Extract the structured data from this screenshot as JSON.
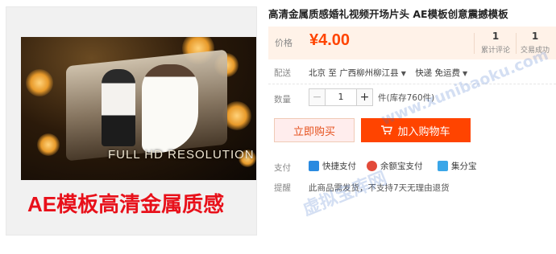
{
  "product": {
    "title": "高清金属质感婚礼视频开场片头 AE模板创意震撼模板",
    "image_caption": "FULL HD RESOLUTION",
    "image_banner": "AE模板高清金属质感"
  },
  "price": {
    "label": "价格",
    "value": "¥4.00",
    "accent_color": "#ff4400"
  },
  "stats": [
    {
      "count": "1",
      "label": "累计评论"
    },
    {
      "count": "1",
      "label": "交易成功"
    }
  ],
  "delivery": {
    "label": "配送",
    "from": "北京 至",
    "to": "广西柳州柳江县",
    "method": "快递 免运费"
  },
  "quantity": {
    "label": "数量",
    "minus": "−",
    "value": "1",
    "plus": "+",
    "stock": "件(库存760件)"
  },
  "actions": {
    "buy_now": "立即购买",
    "add_cart": "加入购物车"
  },
  "payment": {
    "label": "支付",
    "methods": [
      {
        "name": "快捷支付",
        "icon": "quickpay-icon",
        "color": "#2a8ae0"
      },
      {
        "name": "余额宝支付",
        "icon": "yuebao-icon",
        "color": "#e24a3a"
      },
      {
        "name": "集分宝",
        "icon": "jifenbao-icon",
        "color": "#3aa6e8"
      }
    ]
  },
  "notice": {
    "label": "提醒",
    "text": "此商品需发货，不支持7天无理由退货"
  },
  "watermark": {
    "url": "www.xunibaoku.com",
    "text": "虚拟宝库网"
  }
}
